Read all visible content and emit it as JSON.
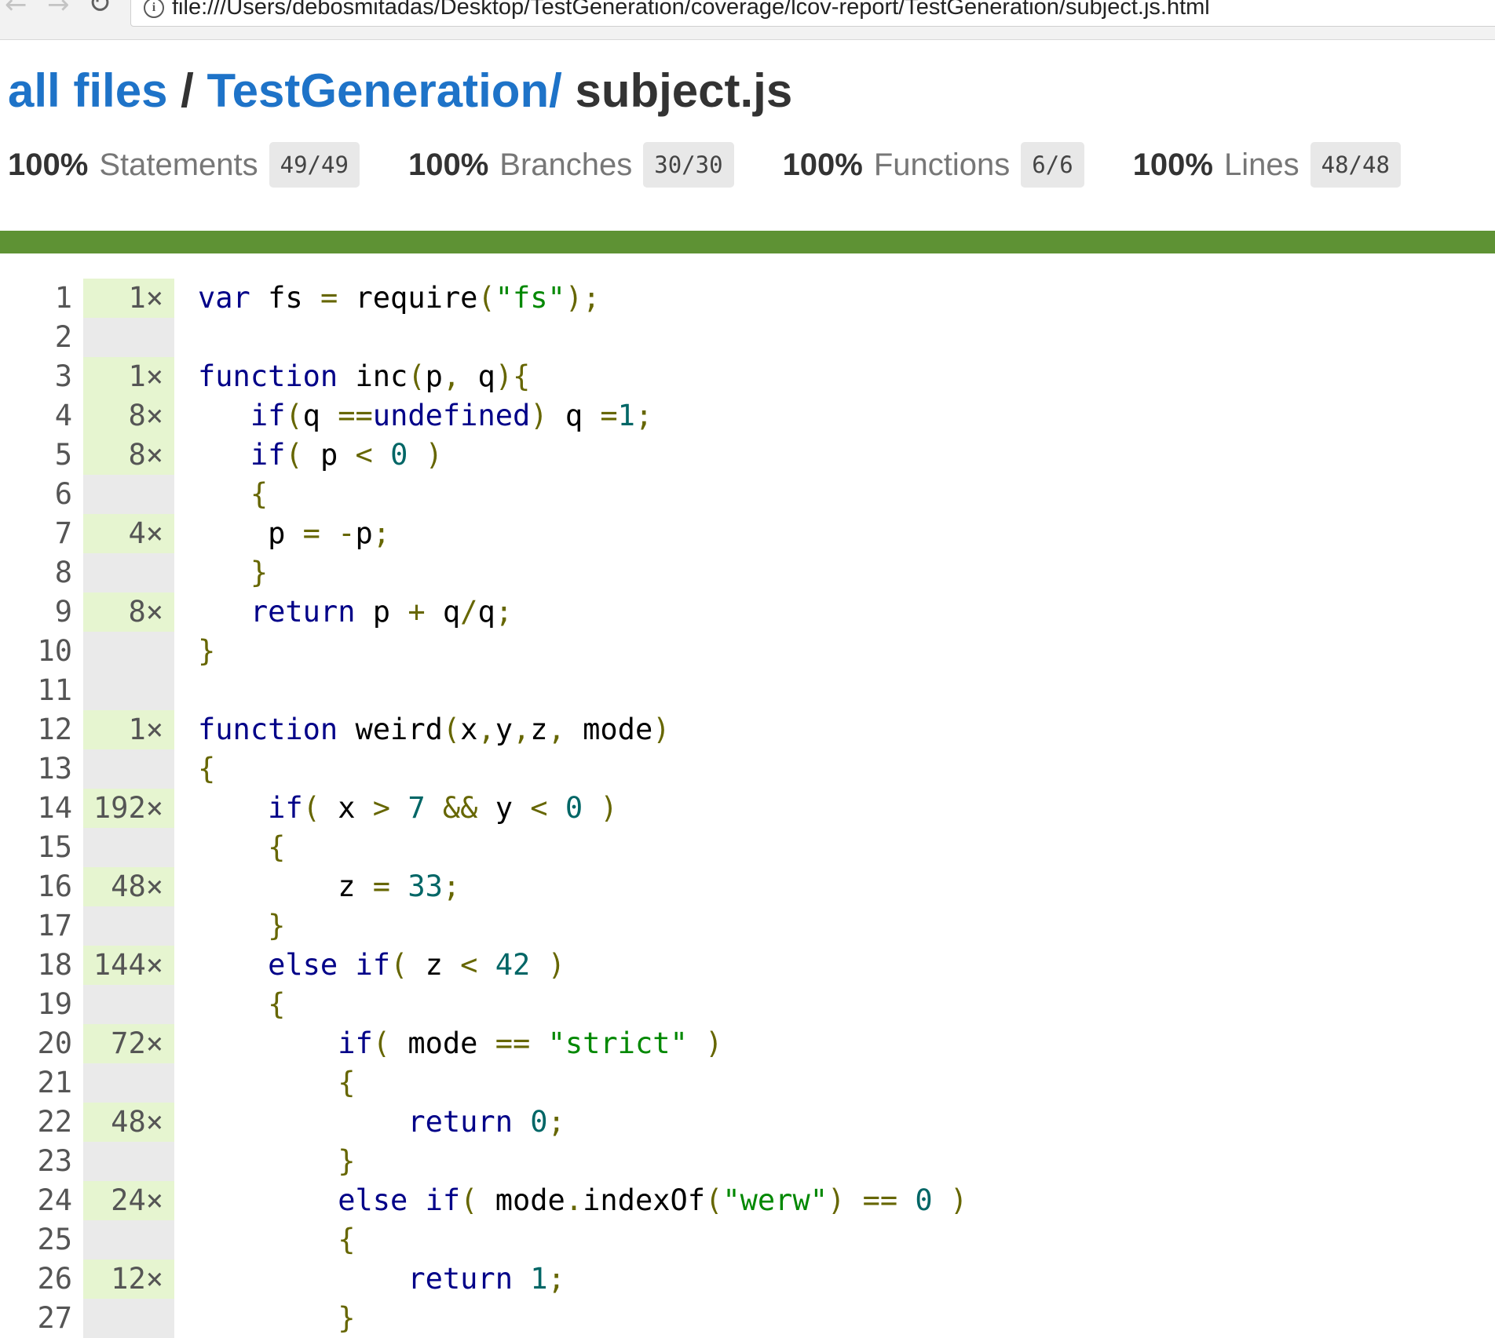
{
  "browser": {
    "url": "file:///Users/debosmitadas/Desktop/TestGeneration/coverage/lcov-report/TestGeneration/subject.js.html"
  },
  "header": {
    "crumb_all": "all files",
    "separator": " / ",
    "crumb_dir": "TestGeneration/",
    "filename": " subject.js"
  },
  "stats": [
    {
      "pct": "100%",
      "label": "Statements",
      "fraction": "49/49"
    },
    {
      "pct": "100%",
      "label": "Branches",
      "fraction": "30/30"
    },
    {
      "pct": "100%",
      "label": "Functions",
      "fraction": "6/6"
    },
    {
      "pct": "100%",
      "label": "Lines",
      "fraction": "48/48"
    }
  ],
  "colors": {
    "status_bar": "#5e9234",
    "covered_hit_bg": "#e6f5d0",
    "neutral_hit_bg": "#eaeaea",
    "link": "#1e73c8"
  },
  "lines": [
    {
      "n": "1",
      "hits": "1×",
      "code": [
        [
          "kwd",
          "var"
        ],
        [
          "pln",
          " fs "
        ],
        [
          "pun",
          "="
        ],
        [
          "pln",
          " require"
        ],
        [
          "pun",
          "("
        ],
        [
          "str",
          "\"fs\""
        ],
        [
          "pun",
          ");"
        ]
      ]
    },
    {
      "n": "2",
      "hits": "",
      "code": []
    },
    {
      "n": "3",
      "hits": "1×",
      "code": [
        [
          "kwd",
          "function"
        ],
        [
          "pln",
          " inc"
        ],
        [
          "pun",
          "("
        ],
        [
          "pln",
          "p"
        ],
        [
          "pun",
          ","
        ],
        [
          "pln",
          " q"
        ],
        [
          "pun",
          "){"
        ]
      ]
    },
    {
      "n": "4",
      "hits": "8×",
      "code": [
        [
          "pln",
          "   "
        ],
        [
          "kwd",
          "if"
        ],
        [
          "pun",
          "("
        ],
        [
          "pln",
          "q "
        ],
        [
          "pun",
          "=="
        ],
        [
          "kwd",
          "undefined"
        ],
        [
          "pun",
          ")"
        ],
        [
          "pln",
          " q "
        ],
        [
          "pun",
          "="
        ],
        [
          "lit",
          "1"
        ],
        [
          "pun",
          ";"
        ]
      ]
    },
    {
      "n": "5",
      "hits": "8×",
      "code": [
        [
          "pln",
          "   "
        ],
        [
          "kwd",
          "if"
        ],
        [
          "pun",
          "("
        ],
        [
          "pln",
          " p "
        ],
        [
          "pun",
          "<"
        ],
        [
          "pln",
          " "
        ],
        [
          "lit",
          "0"
        ],
        [
          "pln",
          " "
        ],
        [
          "pun",
          ")"
        ]
      ]
    },
    {
      "n": "6",
      "hits": "",
      "code": [
        [
          "pln",
          "   "
        ],
        [
          "pun",
          "{"
        ]
      ]
    },
    {
      "n": "7",
      "hits": "4×",
      "code": [
        [
          "pln",
          "    p "
        ],
        [
          "pun",
          "="
        ],
        [
          "pln",
          " "
        ],
        [
          "pun",
          "-"
        ],
        [
          "pln",
          "p"
        ],
        [
          "pun",
          ";"
        ]
      ]
    },
    {
      "n": "8",
      "hits": "",
      "code": [
        [
          "pln",
          "   "
        ],
        [
          "pun",
          "}"
        ]
      ]
    },
    {
      "n": "9",
      "hits": "8×",
      "code": [
        [
          "pln",
          "   "
        ],
        [
          "kwd",
          "return"
        ],
        [
          "pln",
          " p "
        ],
        [
          "pun",
          "+"
        ],
        [
          "pln",
          " q"
        ],
        [
          "pun",
          "/"
        ],
        [
          "pln",
          "q"
        ],
        [
          "pun",
          ";"
        ]
      ]
    },
    {
      "n": "10",
      "hits": "",
      "code": [
        [
          "pun",
          "}"
        ]
      ]
    },
    {
      "n": "11",
      "hits": "",
      "code": []
    },
    {
      "n": "12",
      "hits": "1×",
      "code": [
        [
          "kwd",
          "function"
        ],
        [
          "pln",
          " weird"
        ],
        [
          "pun",
          "("
        ],
        [
          "pln",
          "x"
        ],
        [
          "pun",
          ","
        ],
        [
          "pln",
          "y"
        ],
        [
          "pun",
          ","
        ],
        [
          "pln",
          "z"
        ],
        [
          "pun",
          ","
        ],
        [
          "pln",
          " mode"
        ],
        [
          "pun",
          ")"
        ]
      ]
    },
    {
      "n": "13",
      "hits": "",
      "code": [
        [
          "pun",
          "{"
        ]
      ]
    },
    {
      "n": "14",
      "hits": "192×",
      "code": [
        [
          "pln",
          "    "
        ],
        [
          "kwd",
          "if"
        ],
        [
          "pun",
          "("
        ],
        [
          "pln",
          " x "
        ],
        [
          "pun",
          ">"
        ],
        [
          "pln",
          " "
        ],
        [
          "lit",
          "7"
        ],
        [
          "pln",
          " "
        ],
        [
          "pun",
          "&&"
        ],
        [
          "pln",
          " y "
        ],
        [
          "pun",
          "<"
        ],
        [
          "pln",
          " "
        ],
        [
          "lit",
          "0"
        ],
        [
          "pln",
          " "
        ],
        [
          "pun",
          ")"
        ]
      ]
    },
    {
      "n": "15",
      "hits": "",
      "code": [
        [
          "pln",
          "    "
        ],
        [
          "pun",
          "{"
        ]
      ]
    },
    {
      "n": "16",
      "hits": "48×",
      "code": [
        [
          "pln",
          "        z "
        ],
        [
          "pun",
          "="
        ],
        [
          "pln",
          " "
        ],
        [
          "lit",
          "33"
        ],
        [
          "pun",
          ";"
        ]
      ]
    },
    {
      "n": "17",
      "hits": "",
      "code": [
        [
          "pln",
          "    "
        ],
        [
          "pun",
          "}"
        ]
      ]
    },
    {
      "n": "18",
      "hits": "144×",
      "code": [
        [
          "pln",
          "    "
        ],
        [
          "kwd",
          "else"
        ],
        [
          "pln",
          " "
        ],
        [
          "kwd",
          "if"
        ],
        [
          "pun",
          "("
        ],
        [
          "pln",
          " z "
        ],
        [
          "pun",
          "<"
        ],
        [
          "pln",
          " "
        ],
        [
          "lit",
          "42"
        ],
        [
          "pln",
          " "
        ],
        [
          "pun",
          ")"
        ]
      ]
    },
    {
      "n": "19",
      "hits": "",
      "code": [
        [
          "pln",
          "    "
        ],
        [
          "pun",
          "{"
        ]
      ]
    },
    {
      "n": "20",
      "hits": "72×",
      "code": [
        [
          "pln",
          "        "
        ],
        [
          "kwd",
          "if"
        ],
        [
          "pun",
          "("
        ],
        [
          "pln",
          " mode "
        ],
        [
          "pun",
          "=="
        ],
        [
          "pln",
          " "
        ],
        [
          "str",
          "\"strict\""
        ],
        [
          "pln",
          " "
        ],
        [
          "pun",
          ")"
        ]
      ]
    },
    {
      "n": "21",
      "hits": "",
      "code": [
        [
          "pln",
          "        "
        ],
        [
          "pun",
          "{"
        ]
      ]
    },
    {
      "n": "22",
      "hits": "48×",
      "code": [
        [
          "pln",
          "            "
        ],
        [
          "kwd",
          "return"
        ],
        [
          "pln",
          " "
        ],
        [
          "lit",
          "0"
        ],
        [
          "pun",
          ";"
        ]
      ]
    },
    {
      "n": "23",
      "hits": "",
      "code": [
        [
          "pln",
          "        "
        ],
        [
          "pun",
          "}"
        ]
      ]
    },
    {
      "n": "24",
      "hits": "24×",
      "code": [
        [
          "pln",
          "        "
        ],
        [
          "kwd",
          "else"
        ],
        [
          "pln",
          " "
        ],
        [
          "kwd",
          "if"
        ],
        [
          "pun",
          "("
        ],
        [
          "pln",
          " mode"
        ],
        [
          "pun",
          "."
        ],
        [
          "pln",
          "indexOf"
        ],
        [
          "pun",
          "("
        ],
        [
          "str",
          "\"werw\""
        ],
        [
          "pun",
          ")"
        ],
        [
          "pln",
          " "
        ],
        [
          "pun",
          "=="
        ],
        [
          "pln",
          " "
        ],
        [
          "lit",
          "0"
        ],
        [
          "pln",
          " "
        ],
        [
          "pun",
          ")"
        ]
      ]
    },
    {
      "n": "25",
      "hits": "",
      "code": [
        [
          "pln",
          "        "
        ],
        [
          "pun",
          "{"
        ]
      ]
    },
    {
      "n": "26",
      "hits": "12×",
      "code": [
        [
          "pln",
          "            "
        ],
        [
          "kwd",
          "return"
        ],
        [
          "pln",
          " "
        ],
        [
          "lit",
          "1"
        ],
        [
          "pun",
          ";"
        ]
      ]
    },
    {
      "n": "27",
      "hits": "",
      "code": [
        [
          "pln",
          "        "
        ],
        [
          "pun",
          "}"
        ]
      ]
    }
  ]
}
